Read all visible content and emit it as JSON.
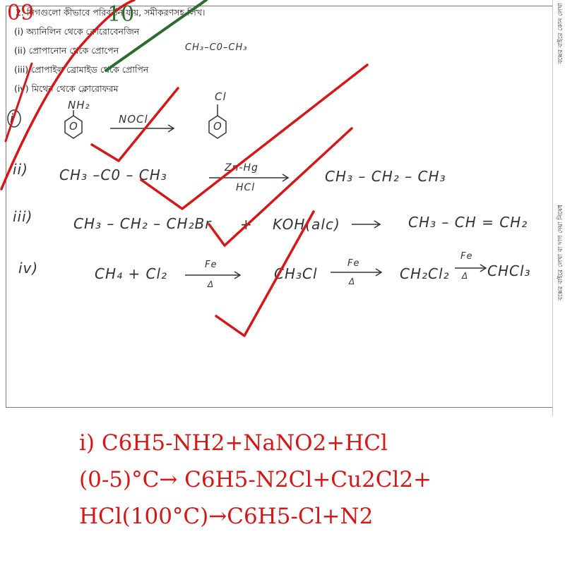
{
  "scores": {
    "mark_red": "09",
    "mark_green": "10"
  },
  "question": {
    "header": "2. নিগগুলো কীভাবে পরিবর্তন যায়, সমীকরণসহ লিখ।",
    "parts": [
      "(i) অ্যানিলিন থেকে ক্লোরোবেনজিন",
      "(ii) প্রোপানোন থেকে প্রোপেন",
      "(iii) প্রোপাইল ব্রোমাইড থেকে প্রোপিন",
      "(iv) মিথেন থেকে ক্লোরোফরম"
    ]
  },
  "handwriting": {
    "margin_note": "CH₃–C0–CH₃",
    "label_i": "i",
    "benzene_sub_top": "NH₂",
    "reagent_i": "NOCl",
    "product_sub_top": "Cl",
    "ring_mark": "O",
    "label_ii": "ii)",
    "reactant_ii": "CH₃ –C0 – CH₃",
    "reagent_ii_top": "Zn-Hg",
    "reagent_ii_bottom": "HCl",
    "product_ii": "CH₃ – CH₂ – CH₃",
    "label_iii": "iii)",
    "reactant_iii": "CH₃ – CH₂ – CH₂Br",
    "plus_iii": "+",
    "reagent_iii": "KOH(alc)",
    "product_iii": "CH₃ – CH = CH₂",
    "label_iv": "iv)",
    "reactant_iv": "CH₄ + Cl₂",
    "cond_fe": "Fe",
    "cond_delta": "Δ",
    "product_iv_1": "CH₃Cl",
    "product_iv_2": "CH₂Cl₂",
    "product_iv_3": "CHCl₃"
  },
  "margin_text": {
    "right_top": "বক্সের বাইরে কোন লেখা",
    "right_bottom": "বক্সের বাইরে লেখা বা দাগ দেয়া নিষেধ"
  },
  "answer": {
    "line1": "i) C6H5-NH2+NaNO2+HCl",
    "line2": " (0-5)°C→ C6H5-N2Cl+Cu2Cl2+",
    "line3": "HCl(100°C)→C6H5-Cl+N2"
  },
  "colors": {
    "ink_red": "#d41717",
    "ink_green": "#2e6b2e",
    "pencil": "#333333"
  }
}
